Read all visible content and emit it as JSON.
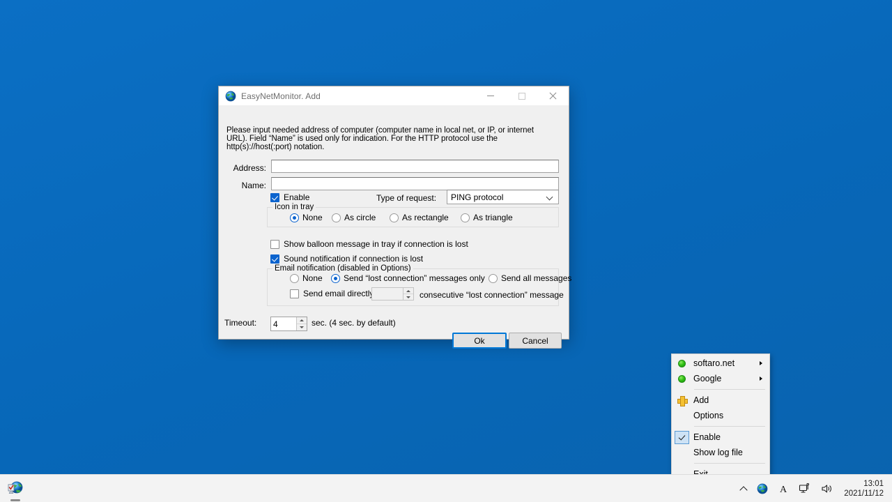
{
  "desktop": {
    "background_color": "#0a6cbf"
  },
  "dialog": {
    "title": "EasyNetMonitor. Add",
    "title_icon": "globe-icon",
    "window_buttons": {
      "minimize": "minimize-icon",
      "maximize": "maximize-icon",
      "close": "close-icon"
    },
    "intro_text": "Please input needed address of computer (computer name in local net, or IP, or internet URL). Field “Name” is used only for indication. For the HTTP protocol use the http(s)://host(:port) notation.",
    "fields": {
      "address_label": "Address:",
      "address_value": "",
      "address_placeholder": "",
      "name_label": "Name:",
      "name_value": "",
      "name_placeholder": ""
    },
    "enable_checkbox": {
      "label": "Enable",
      "checked": true
    },
    "type_of_request": {
      "label": "Type of request:",
      "selected": "PING protocol",
      "options": [
        "PING protocol"
      ]
    },
    "icon_in_tray": {
      "title": "Icon in tray",
      "options": [
        {
          "label": "None",
          "selected": true
        },
        {
          "label": "As circle",
          "selected": false
        },
        {
          "label": "As rectangle",
          "selected": false
        },
        {
          "label": "As triangle",
          "selected": false
        }
      ]
    },
    "balloon_checkbox": {
      "label": "Show balloon message in tray if connection is lost",
      "checked": false
    },
    "sound_checkbox": {
      "label": "Sound notification if connection is lost",
      "checked": true
    },
    "email_group": {
      "title": "Email notification (disabled in Options)",
      "options": [
        {
          "label": "None",
          "selected": false
        },
        {
          "label": "Send “lost connection”  messages only",
          "selected": true
        },
        {
          "label": "Send all messages",
          "selected": false
        }
      ],
      "direct_checkbox": {
        "label": "Send email directly after",
        "checked": false
      },
      "direct_count_value": "",
      "direct_suffix": "consecutive “lost connection” message"
    },
    "timeout": {
      "label": "Timeout:",
      "value": "4",
      "suffix": "sec. (4 sec. by default)"
    },
    "buttons": {
      "ok": "Ok",
      "cancel": "Cancel"
    }
  },
  "context_menu": {
    "items": [
      {
        "label": "softaro.net",
        "icon": "green-status-dot-icon",
        "submenu": true
      },
      {
        "label": "Google",
        "icon": "green-status-dot-icon",
        "submenu": true
      },
      {
        "separator": true
      },
      {
        "label": "Add",
        "icon": "plus-icon",
        "submenu": false
      },
      {
        "label": "Options",
        "icon": "",
        "submenu": false
      },
      {
        "separator": true
      },
      {
        "label": "Enable",
        "icon": "checkmark-icon",
        "checked": true,
        "submenu": false
      },
      {
        "label": "Show log file",
        "icon": "",
        "submenu": false
      },
      {
        "separator": true
      },
      {
        "label": "Exit",
        "icon": "",
        "submenu": false
      }
    ]
  },
  "taskbar": {
    "apps": [
      {
        "name": "easynetmonitor-taskbar-icon",
        "running": true
      }
    ],
    "tray": {
      "show_hidden": "chevron-up-icon",
      "icons": [
        "globe-icon",
        "ime-letter-A-icon",
        "network-icon",
        "volume-icon"
      ]
    },
    "clock": {
      "time": "13:01",
      "date": "2021/11/12"
    }
  }
}
